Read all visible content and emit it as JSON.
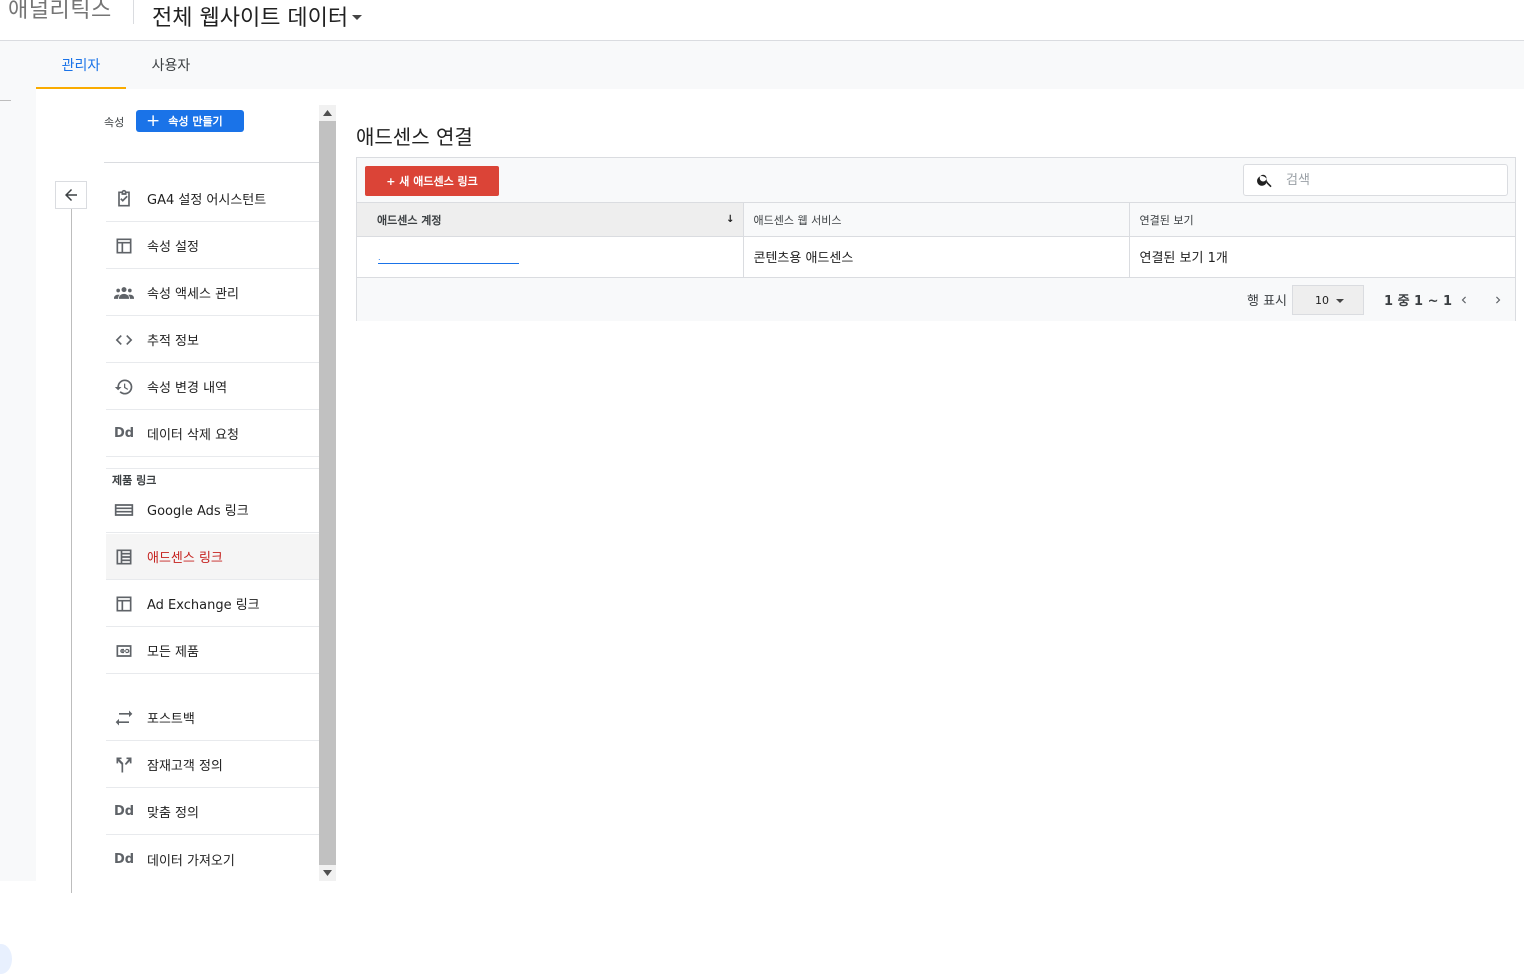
{
  "header": {
    "app_name": "애널리틱스",
    "view_title": "전체 웹사이트 데이터"
  },
  "tabs": [
    {
      "label": "관리자",
      "active": true
    },
    {
      "label": "사용자",
      "active": false
    }
  ],
  "property_column": {
    "label": "속성",
    "create_button": "속성 만들기",
    "items": [
      {
        "label": "GA4 설정 어시스턴트",
        "icon": "clipboard-check-icon"
      },
      {
        "label": "속성 설정",
        "icon": "layout-icon"
      },
      {
        "label": "속성 액세스 관리",
        "icon": "people-icon"
      },
      {
        "label": "추적 정보",
        "icon": "code-icon"
      },
      {
        "label": "속성 변경 내역",
        "icon": "history-icon"
      },
      {
        "label": "데이터 삭제 요청",
        "icon": "dd-icon",
        "icon_text": "Dd"
      }
    ],
    "section_product_links": "제품 링크",
    "product_links": [
      {
        "label": "Google Ads 링크",
        "icon": "ads-icon"
      },
      {
        "label": "애드센스 링크",
        "icon": "adsense-icon",
        "active": true
      },
      {
        "label": "Ad Exchange 링크",
        "icon": "layout-icon"
      },
      {
        "label": "모든 제품",
        "icon": "link-icon"
      }
    ],
    "other_items": [
      {
        "label": "포스트백",
        "icon": "swap-icon"
      },
      {
        "label": "잠재고객 정의",
        "icon": "fork-icon"
      },
      {
        "label": "맞춤 정의",
        "icon": "dd-icon",
        "icon_text": "Dd"
      },
      {
        "label": "데이터 가져오기",
        "icon": "dd-icon",
        "icon_text": "Dd"
      }
    ]
  },
  "main": {
    "title": "애드센스 연결",
    "new_link_button": "+ 새 애드센스 링크",
    "search_placeholder": "검색",
    "table": {
      "columns": [
        "애드센스 계정",
        "애드센스 웹 서비스",
        "연결된 보기"
      ],
      "sort_indicator": "↓",
      "rows": [
        {
          "account": ".",
          "service": "콘텐츠용 애드센스",
          "views": "연결된 보기 1개"
        }
      ]
    },
    "footer": {
      "rows_label": "행 표시",
      "rows_value": "10",
      "range": "1 중 1 ~ 1"
    }
  },
  "colors": {
    "accent": "#1a73e8",
    "red_button": "#db4437",
    "active_nav_text": "#c5221f",
    "tab_indicator": "#f9ab00"
  }
}
